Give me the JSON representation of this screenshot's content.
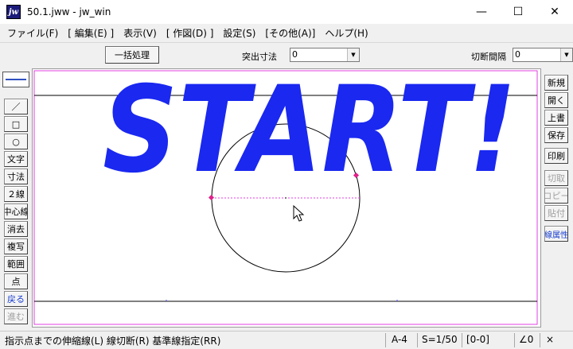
{
  "window": {
    "app_icon_text": "jw",
    "title": "50.1.jww - jw_win",
    "minimize": "—",
    "maximize": "☐",
    "close": "✕"
  },
  "menu": [
    "ファイル(F)",
    "[ 編集(E) ]",
    "表示(V)",
    "[ 作図(D) ]",
    "設定(S)",
    "[その他(A)]",
    "ヘルプ(H)"
  ],
  "toolbar": {
    "batch_button": "一括処理",
    "protrusion_label": "突出寸法",
    "protrusion_value": "0",
    "cut_interval_label": "切断間隔",
    "cut_interval_value": "0"
  },
  "left_tools": {
    "line": "／",
    "rectangle": "□",
    "circle": "○",
    "text": "文字",
    "dimension": "寸法",
    "double_line": "２線",
    "center_line": "中心線",
    "erase": "消去",
    "copy": "複写",
    "range": "範囲",
    "point": "点",
    "undo": "戻る",
    "redo": "進む"
  },
  "right_tools": {
    "new": "新規",
    "open": "開く",
    "overwrite": "上書",
    "save": "保存",
    "print": "印刷",
    "cut": "切取",
    "copy": "コピー",
    "paste": "貼付",
    "line_attr": "線属性"
  },
  "canvas": {
    "overlay_text": "START!",
    "overlay_color": "#1a28f0",
    "frame_color": "#e040e0"
  },
  "status": {
    "message": "指示点までの伸縮線(L) 線切断(R) 基準線指定(RR)",
    "paper": "A-4",
    "scale": "S=1/50",
    "layer": "[0-0]",
    "angle": "∠0",
    "close_glyph": "×"
  }
}
